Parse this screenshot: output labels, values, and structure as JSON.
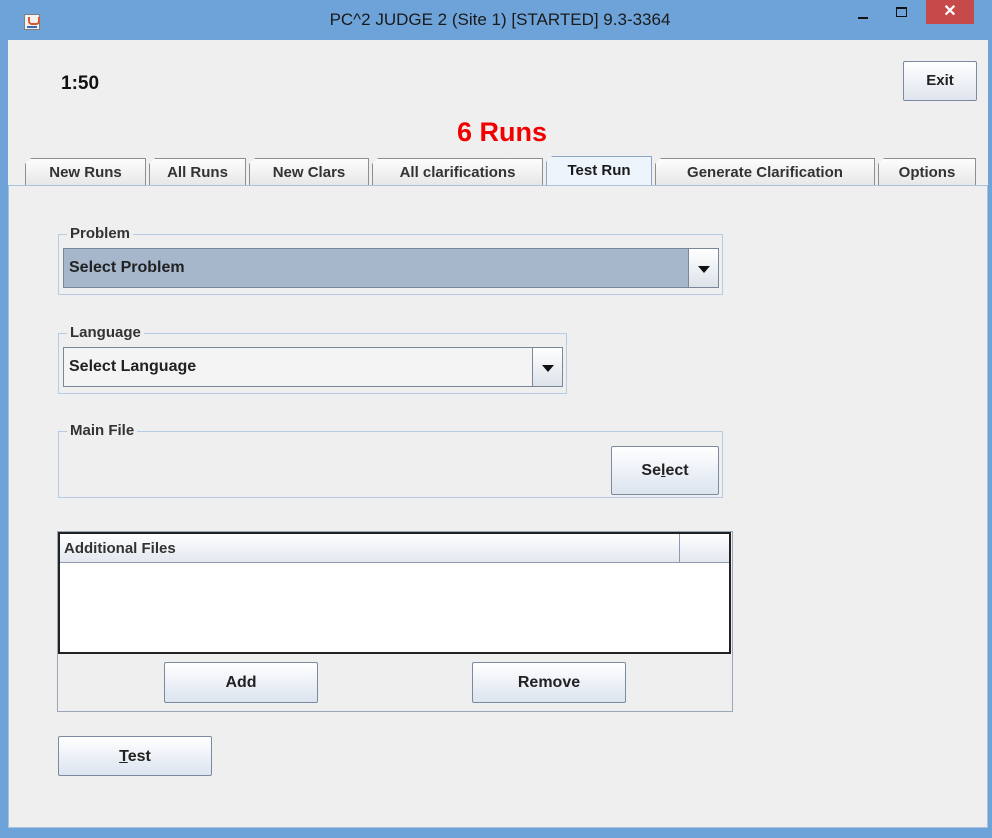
{
  "window": {
    "title": "PC^2 JUDGE 2 (Site 1) [STARTED] 9.3-3364",
    "close_glyph": "✕"
  },
  "header": {
    "clock": "1:50",
    "exit_label": "Exit",
    "runs_label": "6 Runs",
    "runs_color": "#f20000"
  },
  "tabs": [
    {
      "label": "New Runs"
    },
    {
      "label": "All Runs"
    },
    {
      "label": "New Clars"
    },
    {
      "label": "All clarifications"
    },
    {
      "label": "Test Run",
      "active": true
    },
    {
      "label": "Generate Clarification"
    },
    {
      "label": "Options"
    }
  ],
  "test_run": {
    "problem": {
      "legend": "Problem",
      "selected": "Select Problem"
    },
    "language": {
      "legend": "Language",
      "selected": "Select Language"
    },
    "main_file": {
      "legend": "Main File",
      "select_pre": "Se",
      "select_mn": "l",
      "select_post": "ect"
    },
    "additional_files": {
      "column_header": "Additional Files",
      "rows": []
    },
    "add_label": "Add",
    "remove_label": "Remove",
    "test_mn": "T",
    "test_post": "est"
  }
}
